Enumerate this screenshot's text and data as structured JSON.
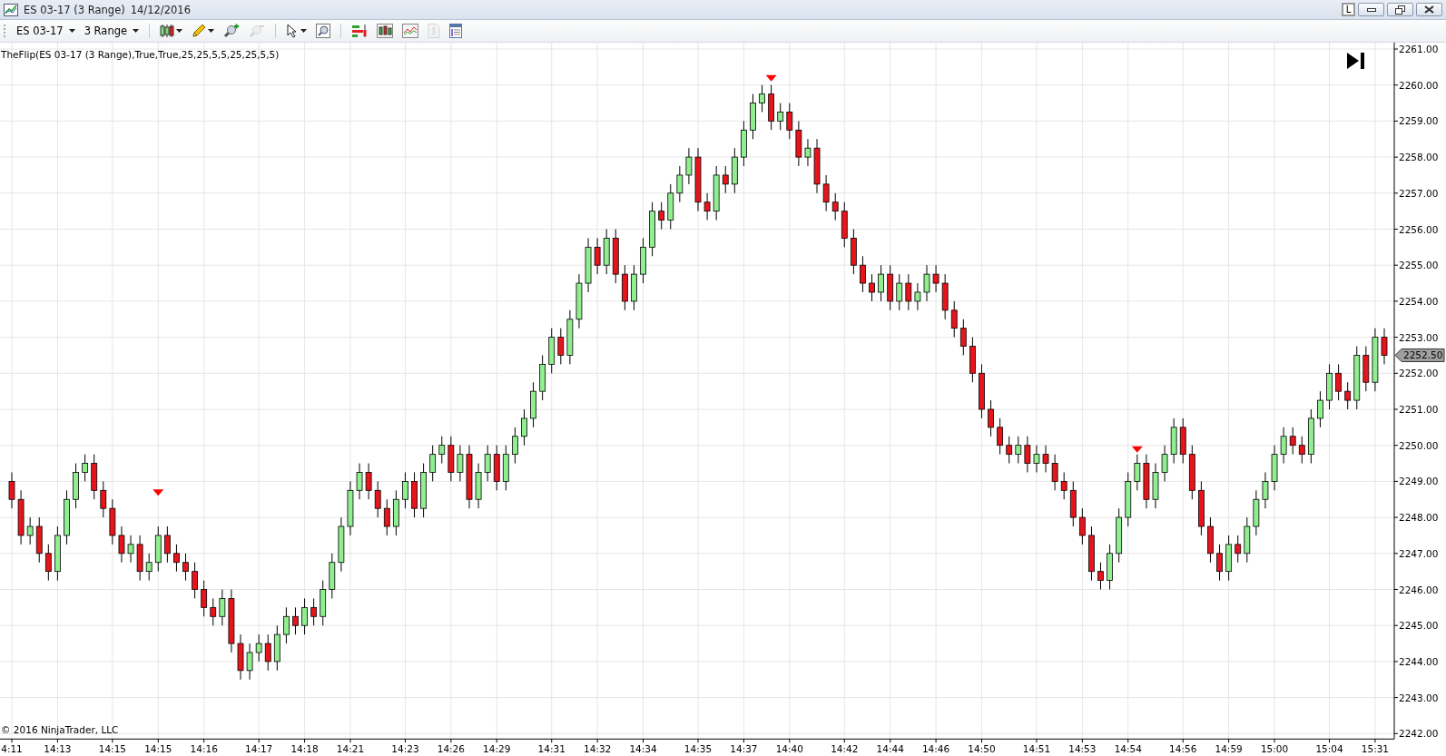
{
  "window": {
    "title": "ES 03-17 (3 Range)",
    "date": "14/12/2016",
    "buttons": [
      {
        "kind": "link",
        "label": "L"
      },
      {
        "kind": "minimize"
      },
      {
        "kind": "restore"
      },
      {
        "kind": "close"
      }
    ]
  },
  "toolbar": {
    "instrument": "ES 03-17",
    "interval": "3 Range",
    "tool_groups": [
      [
        {
          "kind": "candlestick",
          "menu": true,
          "disabled": false
        },
        {
          "kind": "pencil",
          "menu": true,
          "disabled": false
        },
        {
          "kind": "zoom-in",
          "menu": false,
          "disabled": false
        },
        {
          "kind": "zoom-out",
          "menu": false,
          "disabled": true
        }
      ],
      [
        {
          "kind": "pointer",
          "menu": true,
          "disabled": false
        },
        {
          "kind": "zoom-box",
          "menu": false,
          "disabled": false
        }
      ],
      [
        {
          "kind": "bar-panel",
          "menu": false,
          "disabled": false
        },
        {
          "kind": "candlestick-panel",
          "menu": false,
          "disabled": false
        },
        {
          "kind": "line-chart",
          "menu": false,
          "disabled": false
        },
        {
          "kind": "dollar-document",
          "menu": false,
          "disabled": true
        },
        {
          "kind": "properties",
          "menu": false,
          "disabled": false
        }
      ]
    ]
  },
  "chart": {
    "indicator_label": "TheFlip(ES 03-17 (3 Range),True,True,25,25,5,5,25,25,5,5)",
    "copyright": "© 2016 NinjaTrader, LLC",
    "last_price": "2252.50",
    "chart_data": {
      "type": "candlestick",
      "grid": true,
      "ylim": [
        2242,
        2261
      ],
      "yticks": [
        {
          "value": 2242,
          "label": "2242.00"
        },
        {
          "value": 2243,
          "label": "2243.00"
        },
        {
          "value": 2244,
          "label": "2244.00"
        },
        {
          "value": 2245,
          "label": "2245.00"
        },
        {
          "value": 2246,
          "label": "2246.00"
        },
        {
          "value": 2247,
          "label": "2247.00"
        },
        {
          "value": 2248,
          "label": "2248.00"
        },
        {
          "value": 2249,
          "label": "2249.00"
        },
        {
          "value": 2250,
          "label": "2250.00"
        },
        {
          "value": 2251,
          "label": "2251.00"
        },
        {
          "value": 2252,
          "label": "2252.00"
        },
        {
          "value": 2253,
          "label": "2253.00"
        },
        {
          "value": 2254,
          "label": "2254.00"
        },
        {
          "value": 2255,
          "label": "2255.00"
        },
        {
          "value": 2256,
          "label": "2256.00"
        },
        {
          "value": 2257,
          "label": "2257.00"
        },
        {
          "value": 2258,
          "label": "2258.00"
        },
        {
          "value": 2259,
          "label": "2259.00"
        },
        {
          "value": 2260,
          "label": "2260.00"
        },
        {
          "value": 2261,
          "label": "2261.00"
        }
      ],
      "categories": [
        "4:11",
        null,
        null,
        null,
        null,
        "14:13",
        null,
        null,
        null,
        null,
        null,
        "14:15",
        null,
        null,
        null,
        null,
        "14:15",
        null,
        null,
        null,
        null,
        "14:16",
        null,
        null,
        null,
        null,
        null,
        "14:17",
        null,
        null,
        null,
        null,
        "14:18",
        null,
        null,
        null,
        null,
        "14:21",
        null,
        null,
        null,
        null,
        null,
        "14:23",
        null,
        null,
        null,
        null,
        "14:26",
        null,
        null,
        null,
        null,
        "14:29",
        null,
        null,
        null,
        null,
        null,
        "14:31",
        null,
        null,
        null,
        null,
        "14:32",
        null,
        null,
        null,
        null,
        "14:34",
        null,
        null,
        null,
        null,
        null,
        "14:35",
        null,
        null,
        null,
        null,
        "14:37",
        null,
        null,
        null,
        null,
        "14:40",
        null,
        null,
        null,
        null,
        null,
        "14:42",
        null,
        null,
        null,
        null,
        "14:44",
        null,
        null,
        null,
        null,
        "14:46",
        null,
        null,
        null,
        null,
        "14:50",
        null,
        null,
        null,
        null,
        null,
        "14:51",
        null,
        null,
        null,
        null,
        "14:53",
        null,
        null,
        null,
        null,
        "14:54",
        null,
        null,
        null,
        null,
        null,
        "14:56",
        null,
        null,
        null,
        null,
        "14:59",
        null,
        null,
        null,
        null,
        "15:00",
        null,
        null,
        null,
        null,
        null,
        "15:04",
        null,
        null,
        null,
        null,
        "15:31",
        null
      ],
      "ohlc": [
        [
          2249,
          2249.25,
          2248.25,
          2248.5
        ],
        [
          2248.5,
          2248.75,
          2247.25,
          2247.5
        ],
        [
          2247.5,
          2248,
          2247.25,
          2247.75
        ],
        [
          2247.75,
          2248,
          2246.75,
          2247
        ],
        [
          2247,
          2247.25,
          2246.25,
          2246.5
        ],
        [
          2246.5,
          2247.75,
          2246.25,
          2247.5
        ],
        [
          2247.5,
          2248.75,
          2247.25,
          2248.5
        ],
        [
          2248.5,
          2249.5,
          2248.25,
          2249.25
        ],
        [
          2249.25,
          2249.75,
          2249,
          2249.5
        ],
        [
          2249.5,
          2249.75,
          2248.5,
          2248.75
        ],
        [
          2248.75,
          2249,
          2248,
          2248.25
        ],
        [
          2248.25,
          2248.5,
          2247.25,
          2247.5
        ],
        [
          2247.5,
          2247.75,
          2246.75,
          2247
        ],
        [
          2247,
          2247.5,
          2246.75,
          2247.25
        ],
        [
          2247.25,
          2247.5,
          2246.25,
          2246.5
        ],
        [
          2246.5,
          2247,
          2246.25,
          2246.75
        ],
        [
          2246.75,
          2247.75,
          2246.5,
          2247.5
        ],
        [
          2247.5,
          2247.75,
          2246.75,
          2247
        ],
        [
          2247,
          2247.25,
          2246.5,
          2246.75
        ],
        [
          2246.75,
          2247,
          2246.25,
          2246.5
        ],
        [
          2246.5,
          2246.75,
          2245.75,
          2246
        ],
        [
          2246,
          2246.25,
          2245.25,
          2245.5
        ],
        [
          2245.5,
          2245.75,
          2245,
          2245.25
        ],
        [
          2245.25,
          2246,
          2245,
          2245.75
        ],
        [
          2245.75,
          2246,
          2244.25,
          2244.5
        ],
        [
          2244.5,
          2244.75,
          2243.5,
          2243.75
        ],
        [
          2243.75,
          2244.5,
          2243.5,
          2244.25
        ],
        [
          2244.25,
          2244.75,
          2244,
          2244.5
        ],
        [
          2244.5,
          2244.75,
          2243.75,
          2244
        ],
        [
          2244,
          2245,
          2243.75,
          2244.75
        ],
        [
          2244.75,
          2245.5,
          2244.5,
          2245.25
        ],
        [
          2245.25,
          2245.5,
          2244.75,
          2245
        ],
        [
          2245,
          2245.75,
          2244.75,
          2245.5
        ],
        [
          2245.5,
          2245.75,
          2245,
          2245.25
        ],
        [
          2245.25,
          2246.25,
          2245,
          2246
        ],
        [
          2246,
          2247,
          2245.75,
          2246.75
        ],
        [
          2246.75,
          2248,
          2246.5,
          2247.75
        ],
        [
          2247.75,
          2249,
          2247.5,
          2248.75
        ],
        [
          2248.75,
          2249.5,
          2248.5,
          2249.25
        ],
        [
          2249.25,
          2249.5,
          2248.5,
          2248.75
        ],
        [
          2248.75,
          2249,
          2248,
          2248.25
        ],
        [
          2248.25,
          2248.5,
          2247.5,
          2247.75
        ],
        [
          2247.75,
          2248.75,
          2247.5,
          2248.5
        ],
        [
          2248.5,
          2249.25,
          2248.25,
          2249
        ],
        [
          2249,
          2249.25,
          2248,
          2248.25
        ],
        [
          2248.25,
          2249.5,
          2248,
          2249.25
        ],
        [
          2249.25,
          2250,
          2249,
          2249.75
        ],
        [
          2249.75,
          2250.25,
          2249.5,
          2250
        ],
        [
          2250,
          2250.25,
          2249,
          2249.25
        ],
        [
          2249.25,
          2250,
          2249,
          2249.75
        ],
        [
          2249.75,
          2250,
          2248.25,
          2248.5
        ],
        [
          2248.5,
          2249.5,
          2248.25,
          2249.25
        ],
        [
          2249.25,
          2250,
          2249,
          2249.75
        ],
        [
          2249.75,
          2250,
          2248.75,
          2249
        ],
        [
          2249,
          2250,
          2248.75,
          2249.75
        ],
        [
          2249.75,
          2250.5,
          2249.5,
          2250.25
        ],
        [
          2250.25,
          2251,
          2250,
          2250.75
        ],
        [
          2250.75,
          2251.75,
          2250.5,
          2251.5
        ],
        [
          2251.5,
          2252.5,
          2251.25,
          2252.25
        ],
        [
          2252.25,
          2253.25,
          2252,
          2253
        ],
        [
          2253,
          2253.25,
          2252.25,
          2252.5
        ],
        [
          2252.5,
          2253.75,
          2252.25,
          2253.5
        ],
        [
          2253.5,
          2254.75,
          2253.25,
          2254.5
        ],
        [
          2254.5,
          2255.75,
          2254.25,
          2255.5
        ],
        [
          2255.5,
          2255.75,
          2254.75,
          2255
        ],
        [
          2255,
          2256,
          2254.75,
          2255.75
        ],
        [
          2255.75,
          2256,
          2254.5,
          2254.75
        ],
        [
          2254.75,
          2255,
          2253.75,
          2254
        ],
        [
          2254,
          2255,
          2253.75,
          2254.75
        ],
        [
          2254.75,
          2255.75,
          2254.5,
          2255.5
        ],
        [
          2255.5,
          2256.75,
          2255.25,
          2256.5
        ],
        [
          2256.5,
          2256.75,
          2256,
          2256.25
        ],
        [
          2256.25,
          2257.25,
          2256,
          2257
        ],
        [
          2257,
          2257.75,
          2256.75,
          2257.5
        ],
        [
          2257.5,
          2258.25,
          2257.25,
          2258
        ],
        [
          2258,
          2258.25,
          2256.5,
          2256.75
        ],
        [
          2256.75,
          2257,
          2256.25,
          2256.5
        ],
        [
          2256.5,
          2257.75,
          2256.25,
          2257.5
        ],
        [
          2257.5,
          2257.75,
          2257,
          2257.25
        ],
        [
          2257.25,
          2258.25,
          2257,
          2258
        ],
        [
          2258,
          2259,
          2257.75,
          2258.75
        ],
        [
          2258.75,
          2259.75,
          2258.5,
          2259.5
        ],
        [
          2259.5,
          2260,
          2259.25,
          2259.75
        ],
        [
          2259.75,
          2260,
          2258.75,
          2259
        ],
        [
          2259,
          2259.5,
          2258.75,
          2259.25
        ],
        [
          2259.25,
          2259.5,
          2258.5,
          2258.75
        ],
        [
          2258.75,
          2259,
          2257.75,
          2258
        ],
        [
          2258,
          2258.5,
          2257.75,
          2258.25
        ],
        [
          2258.25,
          2258.5,
          2257,
          2257.25
        ],
        [
          2257.25,
          2257.5,
          2256.5,
          2256.75
        ],
        [
          2256.75,
          2257,
          2256.25,
          2256.5
        ],
        [
          2256.5,
          2256.75,
          2255.5,
          2255.75
        ],
        [
          2255.75,
          2256,
          2254.75,
          2255
        ],
        [
          2255,
          2255.25,
          2254.25,
          2254.5
        ],
        [
          2254.5,
          2254.75,
          2254,
          2254.25
        ],
        [
          2254.25,
          2255,
          2254,
          2254.75
        ],
        [
          2254.75,
          2255,
          2253.75,
          2254
        ],
        [
          2254,
          2254.75,
          2253.75,
          2254.5
        ],
        [
          2254.5,
          2254.75,
          2253.75,
          2254
        ],
        [
          2254,
          2254.5,
          2253.75,
          2254.25
        ],
        [
          2254.25,
          2255,
          2254,
          2254.75
        ],
        [
          2254.75,
          2255,
          2254.25,
          2254.5
        ],
        [
          2254.5,
          2254.75,
          2253.5,
          2253.75
        ],
        [
          2253.75,
          2254,
          2253,
          2253.25
        ],
        [
          2253.25,
          2253.5,
          2252.5,
          2252.75
        ],
        [
          2252.75,
          2253,
          2251.75,
          2252
        ],
        [
          2252,
          2252.25,
          2250.75,
          2251
        ],
        [
          2251,
          2251.25,
          2250.25,
          2250.5
        ],
        [
          2250.5,
          2250.75,
          2249.75,
          2250
        ],
        [
          2250,
          2250.25,
          2249.5,
          2249.75
        ],
        [
          2249.75,
          2250.25,
          2249.5,
          2250
        ],
        [
          2250,
          2250.25,
          2249.25,
          2249.5
        ],
        [
          2249.5,
          2250,
          2249.25,
          2249.75
        ],
        [
          2249.75,
          2250,
          2249.25,
          2249.5
        ],
        [
          2249.5,
          2249.75,
          2248.75,
          2249
        ],
        [
          2249,
          2249.25,
          2248.5,
          2248.75
        ],
        [
          2248.75,
          2249,
          2247.75,
          2248
        ],
        [
          2248,
          2248.25,
          2247.25,
          2247.5
        ],
        [
          2247.5,
          2247.75,
          2246.25,
          2246.5
        ],
        [
          2246.5,
          2246.75,
          2246,
          2246.25
        ],
        [
          2246.25,
          2247.25,
          2246,
          2247
        ],
        [
          2247,
          2248.25,
          2246.75,
          2248
        ],
        [
          2248,
          2249.25,
          2247.75,
          2249
        ],
        [
          2249,
          2249.75,
          2248.75,
          2249.5
        ],
        [
          2249.5,
          2249.75,
          2248.25,
          2248.5
        ],
        [
          2248.5,
          2249.5,
          2248.25,
          2249.25
        ],
        [
          2249.25,
          2250,
          2249,
          2249.75
        ],
        [
          2249.75,
          2250.75,
          2249.5,
          2250.5
        ],
        [
          2250.5,
          2250.75,
          2249.5,
          2249.75
        ],
        [
          2249.75,
          2250,
          2248.5,
          2248.75
        ],
        [
          2248.75,
          2249,
          2247.5,
          2247.75
        ],
        [
          2247.75,
          2248,
          2246.75,
          2247
        ],
        [
          2247,
          2247.25,
          2246.25,
          2246.5
        ],
        [
          2246.5,
          2247.5,
          2246.25,
          2247.25
        ],
        [
          2247.25,
          2247.5,
          2246.75,
          2247
        ],
        [
          2247,
          2248,
          2246.75,
          2247.75
        ],
        [
          2247.75,
          2248.75,
          2247.5,
          2248.5
        ],
        [
          2248.5,
          2249.25,
          2248.25,
          2249
        ],
        [
          2249,
          2250,
          2248.75,
          2249.75
        ],
        [
          2249.75,
          2250.5,
          2249.5,
          2250.25
        ],
        [
          2250.25,
          2250.5,
          2249.75,
          2250
        ],
        [
          2250,
          2250.25,
          2249.5,
          2249.75
        ],
        [
          2249.75,
          2251,
          2249.5,
          2250.75
        ],
        [
          2250.75,
          2251.5,
          2250.5,
          2251.25
        ],
        [
          2251.25,
          2252.25,
          2251,
          2252
        ],
        [
          2252,
          2252.25,
          2251.25,
          2251.5
        ],
        [
          2251.5,
          2251.75,
          2251,
          2251.25
        ],
        [
          2251.25,
          2252.75,
          2251,
          2252.5
        ],
        [
          2252.5,
          2252.75,
          2251.5,
          2251.75
        ],
        [
          2251.75,
          2253.25,
          2251.5,
          2253
        ],
        [
          2253,
          2253.25,
          2252.25,
          2252.5
        ]
      ]
    }
  }
}
